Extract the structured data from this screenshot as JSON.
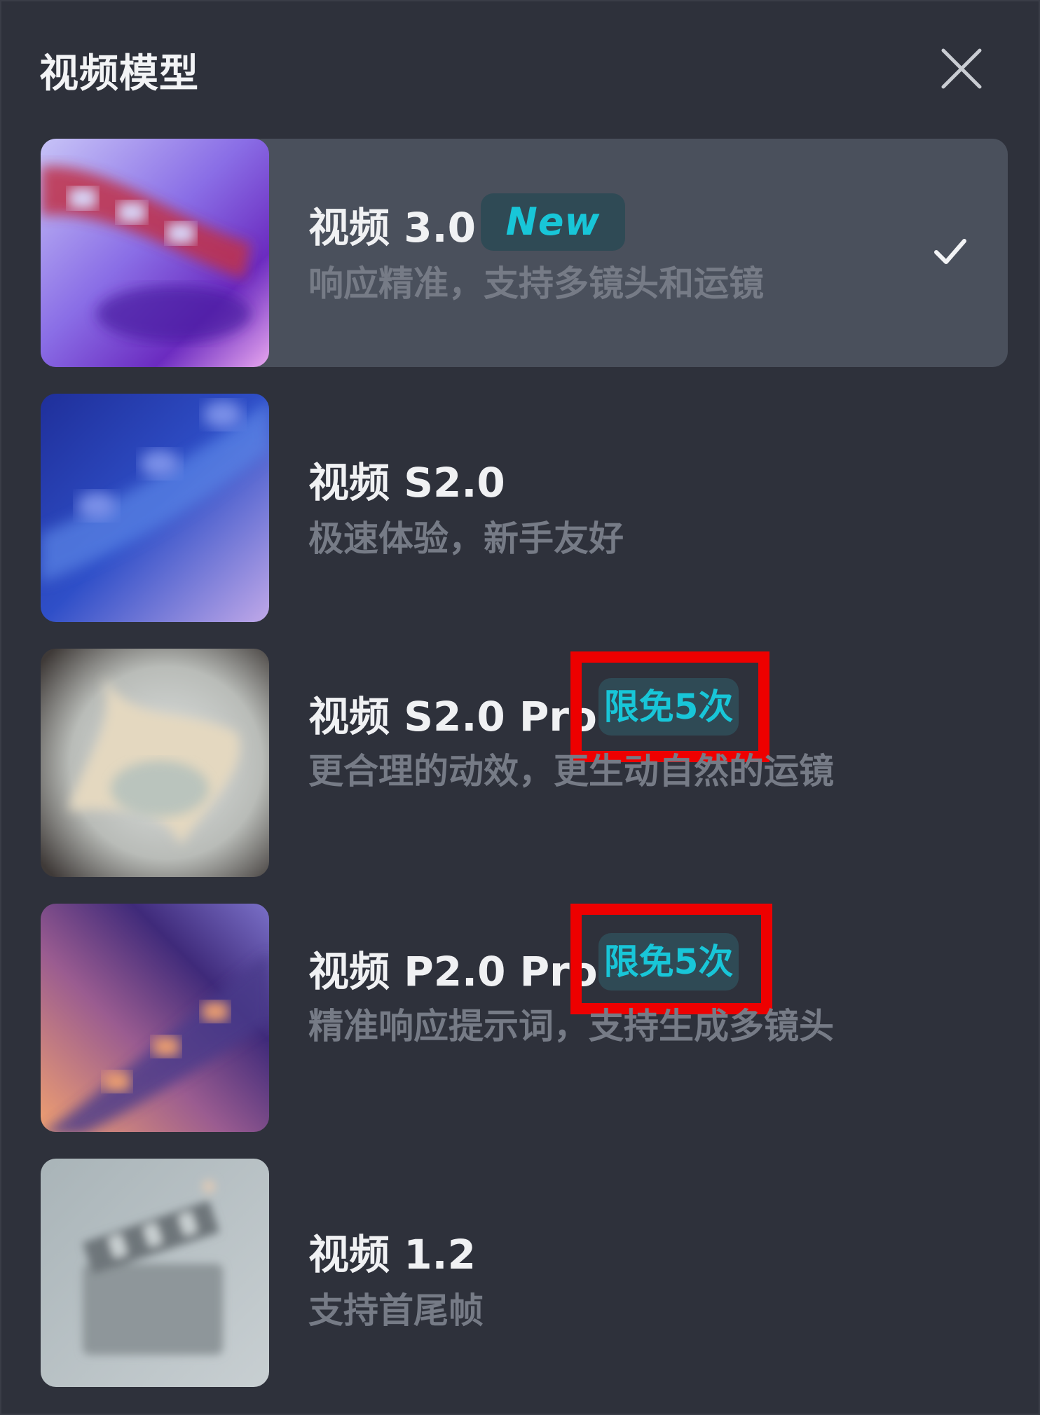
{
  "panel": {
    "title": "视频模型",
    "close_icon": "close-icon"
  },
  "models": [
    {
      "name": "视频 3.0",
      "badge": "New",
      "description": "响应精准，支持多镜头和运镜",
      "selected": true
    },
    {
      "name": "视频 S2.0",
      "badge": "",
      "description": "极速体验，新手友好",
      "selected": false
    },
    {
      "name": "视频 S2.0 Pro",
      "badge": "限免5次",
      "description": "更合理的动效，更生动自然的运镜",
      "selected": false
    },
    {
      "name": "视频 P2.0 Pro",
      "badge": "限免5次",
      "description": "精准响应提示词，支持生成多镜头",
      "selected": false
    },
    {
      "name": "视频 1.2",
      "badge": "",
      "description": "支持首尾帧",
      "selected": false
    }
  ],
  "colors": {
    "background": "#2e313b",
    "selected_row": "#4a505c",
    "badge_bg": "#2f4a55",
    "badge_text": "#18c6d8",
    "highlight": "#ee0000"
  }
}
